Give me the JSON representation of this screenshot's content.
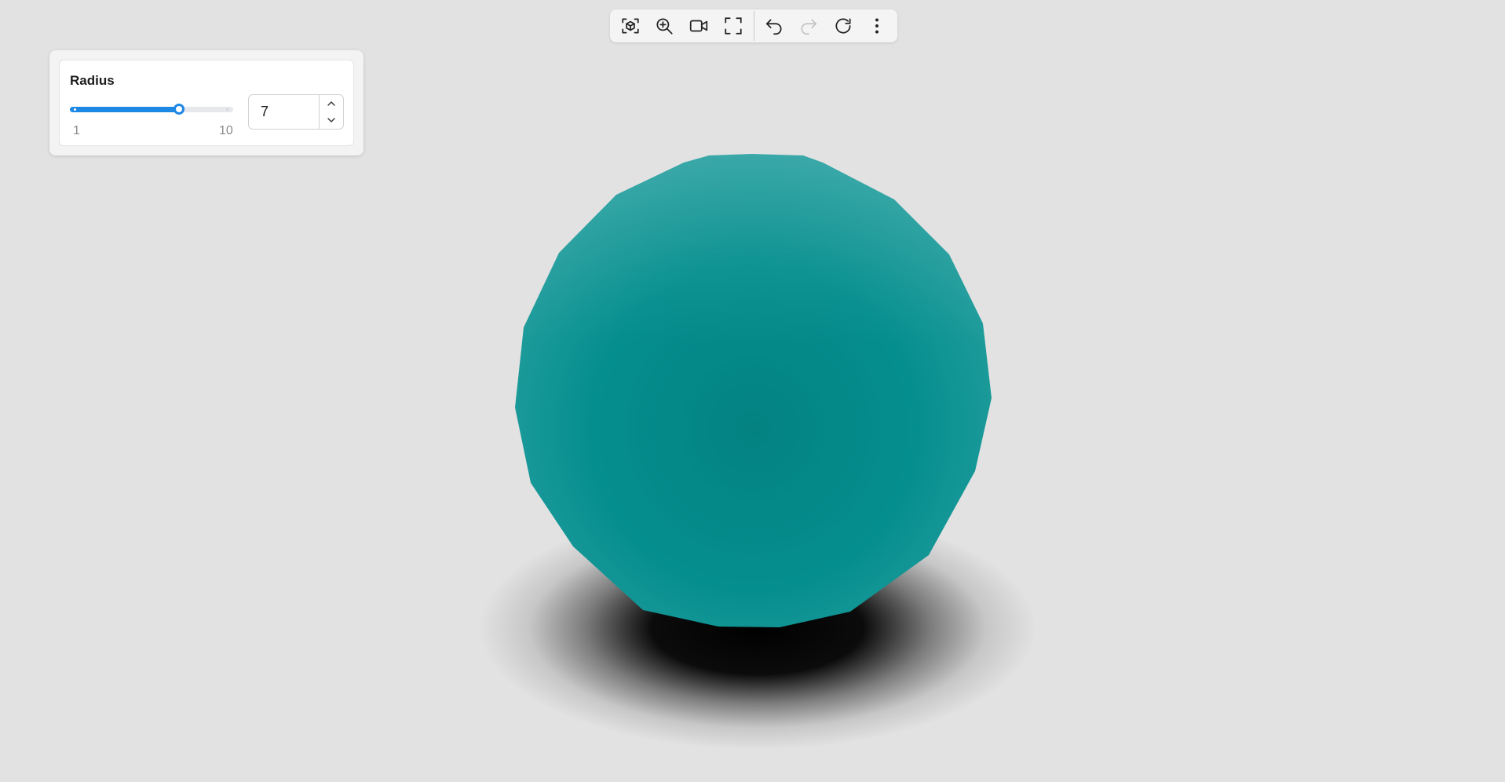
{
  "toolbar": {
    "buttons": [
      {
        "name": "view-cube-button",
        "icon": "view-cube-icon",
        "enabled": true
      },
      {
        "name": "zoom-to-fit-button",
        "icon": "zoom-in-icon",
        "enabled": true
      },
      {
        "name": "camera-button",
        "icon": "video-camera-icon",
        "enabled": true
      },
      {
        "name": "fullscreen-button",
        "icon": "fullscreen-icon",
        "enabled": true
      },
      {
        "name": "undo-button",
        "icon": "undo-icon",
        "enabled": true
      },
      {
        "name": "redo-button",
        "icon": "redo-icon",
        "enabled": false
      },
      {
        "name": "reload-button",
        "icon": "reload-icon",
        "enabled": true
      },
      {
        "name": "more-options-button",
        "icon": "more-vertical-icon",
        "enabled": true
      }
    ]
  },
  "panel": {
    "parameter": {
      "label": "Radius",
      "min": "1",
      "max": "10",
      "value": "7",
      "value_fraction": 0.667
    }
  },
  "colors": {
    "accent": "#1e88e5",
    "sphere": "#058d8d",
    "sphere_highlight": "#2aa0a0",
    "background": "#e2e2e2",
    "shadow": "#000000"
  }
}
